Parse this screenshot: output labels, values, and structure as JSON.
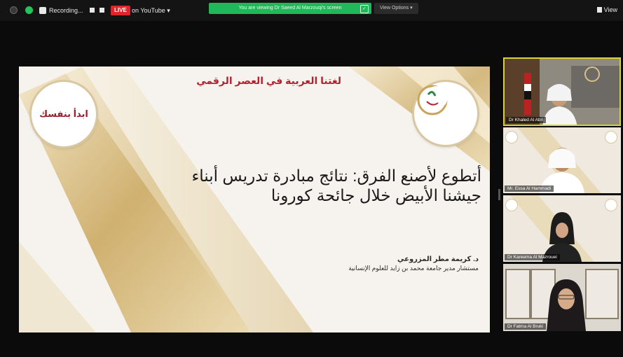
{
  "toolbar": {
    "recording_label": "Recording...",
    "live_label": "LIVE",
    "youtube_label": "on YouTube",
    "share_banner": "You are viewing Dr Saeed Al Marzouqi's screen",
    "view_options_label": "View Options",
    "view_label": "View"
  },
  "slide": {
    "title": "لغتنا العربية في العصر الرقمي",
    "main_text": "أتطوع لأصنع الفرق: نتائج مبادرة تدريس أبناء جيشنا الأبيض خلال جائحة كورونا",
    "author_name": "د. كريمة مطر المزروعي",
    "author_role": "مستشار مدير جامعة محمد بن زايد للعلوم الإنسانية",
    "left_logo_text": "ابدأ بنفسك"
  },
  "participants": [
    {
      "name": "Dr Khaled Al Abri"
    },
    {
      "name": "Mr. Essa Al Hammadi"
    },
    {
      "name": "Dr Kareema Al Mazrouei"
    },
    {
      "name": "Dr Fatma Al Bruki"
    }
  ],
  "colors": {
    "live_red": "#e0242b",
    "banner_green": "#1fb85a",
    "active_speaker": "#d8d233",
    "slide_title": "#b5222f",
    "gold": "#c9a55a"
  }
}
